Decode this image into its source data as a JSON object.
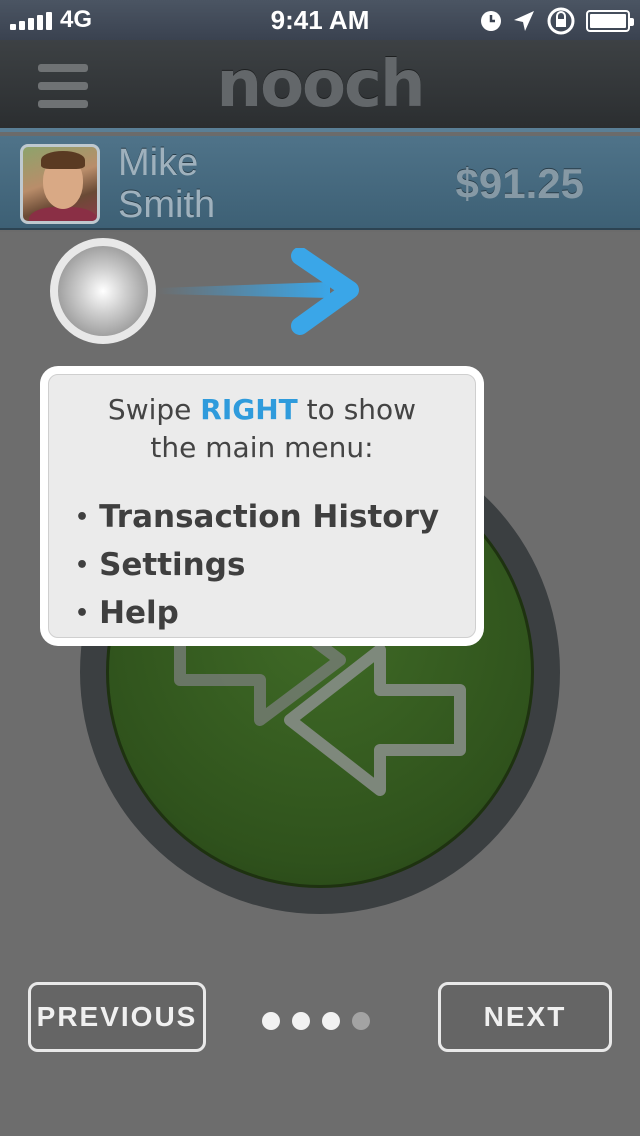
{
  "status_bar": {
    "carrier": "4G",
    "time": "9:41 AM",
    "icons": [
      "signal-bars-icon",
      "clock-icon",
      "location-arrow-icon",
      "rotation-lock-icon",
      "battery-icon"
    ]
  },
  "navbar": {
    "menu_icon": "hamburger-menu-icon",
    "logo": "nooch"
  },
  "user": {
    "first_name": "Mike",
    "last_name": "Smith",
    "balance": "$91.25"
  },
  "tutorial": {
    "swipe_prefix": "Swipe ",
    "swipe_direction": "RIGHT",
    "swipe_suffix": " to show",
    "line2": "the main menu:",
    "menu_items": [
      {
        "label": "Transaction History"
      },
      {
        "label": "Settings"
      },
      {
        "label": "Help"
      }
    ]
  },
  "pager": {
    "previous_label": "PREVIOUS",
    "next_label": "NEXT",
    "page_count": 4,
    "current_page": 3
  },
  "colors": {
    "accent_blue": "#2f9bdc",
    "user_bar": "#4f7389",
    "button_green": "#3f6a26"
  }
}
